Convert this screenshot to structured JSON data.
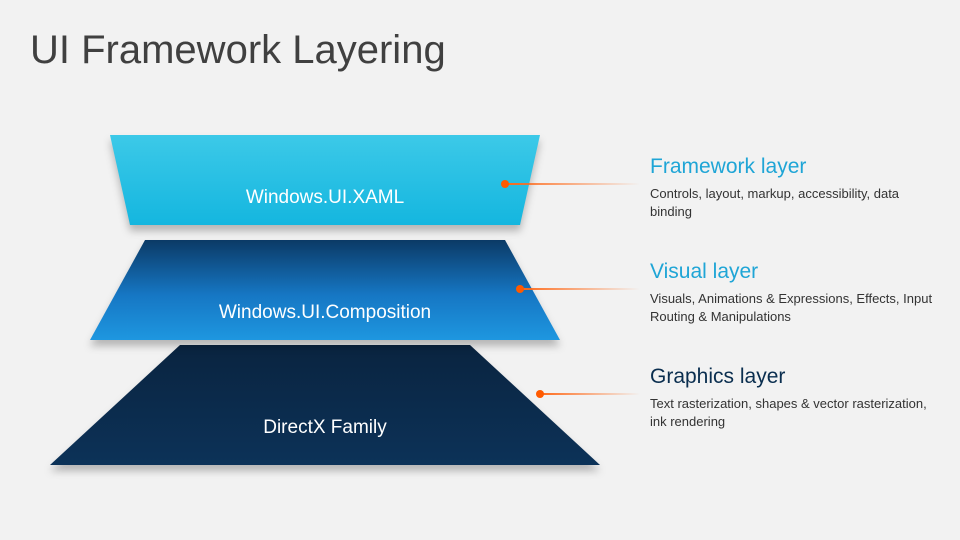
{
  "title": "UI Framework Layering",
  "layers": [
    {
      "label": "Windows.UI.XAML",
      "callout_title": "Framework layer",
      "callout_desc": "Controls, layout, markup, accessibility, data binding",
      "callout_color": "#1fa5d6",
      "fill_top": "#38c6e6",
      "fill_bottom": "#18b7de"
    },
    {
      "label": "Windows.UI.Composition",
      "callout_title": "Visual layer",
      "callout_desc": "Visuals, Animations & Expressions, Effects, Input Routing & Manipulations",
      "callout_color": "#1fa5d6",
      "fill_top": "#0a3d6b",
      "fill_bottom": "#1a8fdc"
    },
    {
      "label": "DirectX Family",
      "callout_title": "Graphics layer",
      "callout_desc": "Text rasterization, shapes & vector rasterization, ink rendering",
      "callout_color": "#0a2e4f",
      "fill_top": "#0a2440",
      "fill_bottom": "#0a2b4d"
    }
  ]
}
